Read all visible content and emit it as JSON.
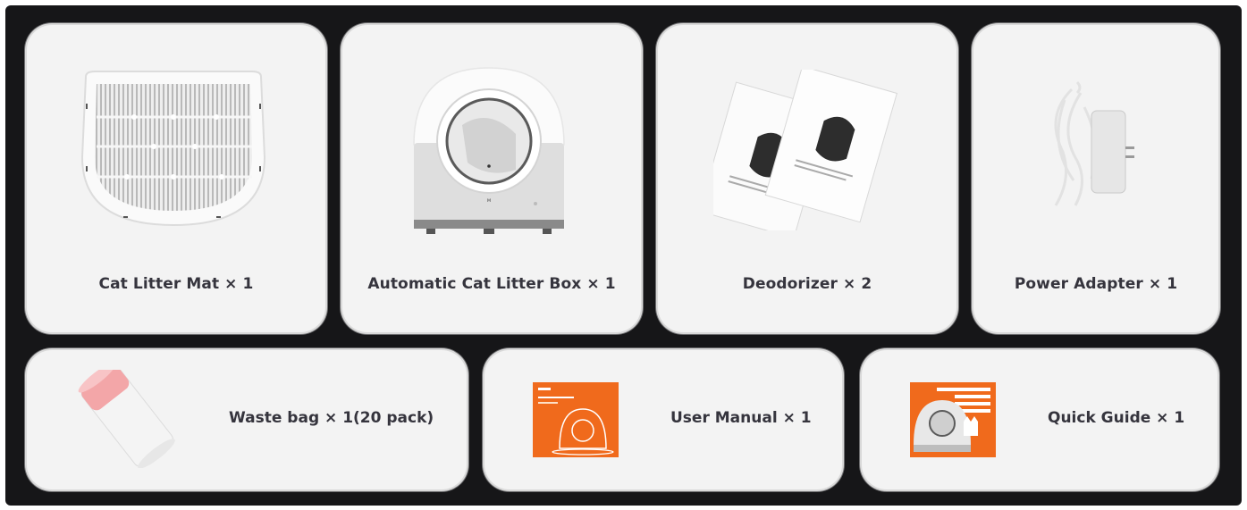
{
  "items": [
    {
      "label": "Cat Litter Mat × 1",
      "icon": "litter-mat-icon"
    },
    {
      "label": "Automatic Cat Litter Box × 1",
      "icon": "litter-box-icon"
    },
    {
      "label": "Deodorizer × 2",
      "icon": "deodorizer-pack-icon"
    },
    {
      "label": "Power Adapter × 1",
      "icon": "power-adapter-icon"
    },
    {
      "label": "Waste bag × 1(20 pack)",
      "icon": "waste-bag-roll-icon"
    },
    {
      "label": "User Manual × 1",
      "icon": "user-manual-icon"
    },
    {
      "label": "Quick Guide × 1",
      "icon": "quick-guide-icon"
    }
  ],
  "colors": {
    "background": "#161618",
    "card": "#f3f3f3",
    "label": "#35343d",
    "manual_orange": "#f06a1c",
    "bag_pink": "#f3a6a8"
  }
}
